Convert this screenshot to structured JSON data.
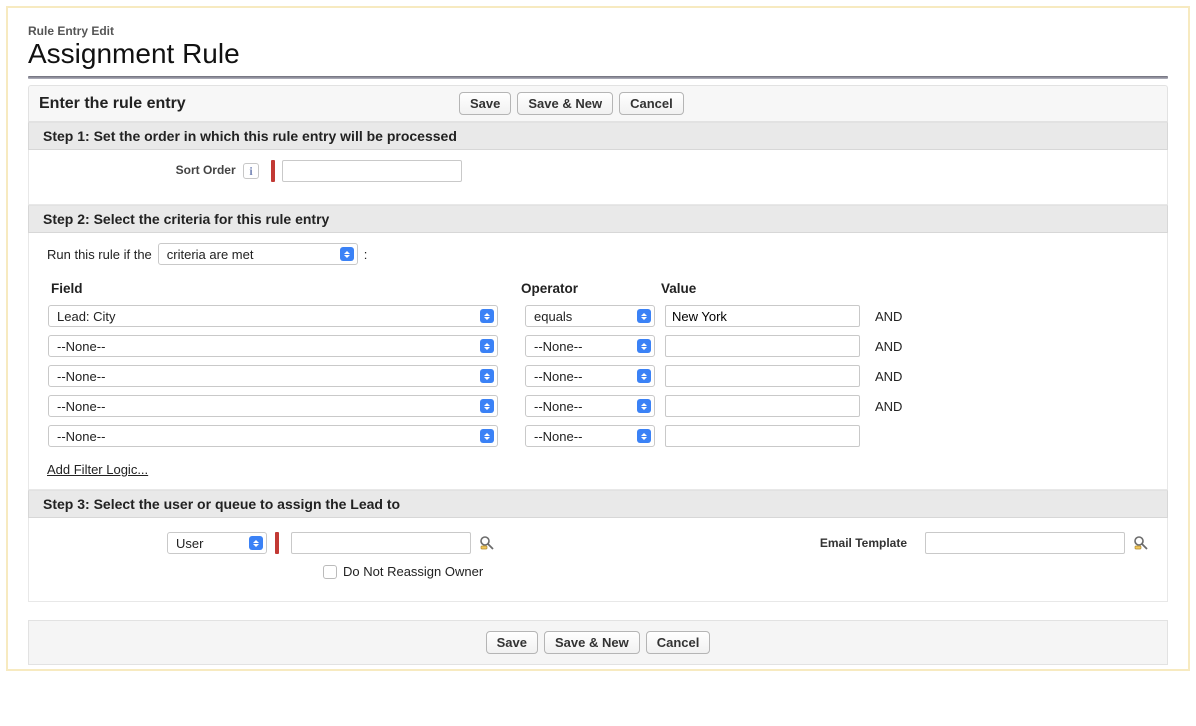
{
  "header": {
    "subtitle": "Rule Entry Edit",
    "title": "Assignment Rule"
  },
  "topbar": {
    "heading": "Enter the rule entry"
  },
  "buttons": {
    "save": "Save",
    "save_new": "Save & New",
    "cancel": "Cancel"
  },
  "step1": {
    "title": "Step 1: Set the order in which this rule entry will be processed",
    "sort_order_label": "Sort Order",
    "sort_order_value": ""
  },
  "step2": {
    "title": "Step 2: Select the criteria for this rule entry",
    "run_prefix": "Run this rule if the",
    "run_select": "criteria are met",
    "colon": ":",
    "cols": {
      "field": "Field",
      "operator": "Operator",
      "value": "Value"
    },
    "and_label": "AND",
    "rows": [
      {
        "field": "Lead: City",
        "operator": "equals",
        "value": "New York",
        "show_and": true
      },
      {
        "field": "--None--",
        "operator": "--None--",
        "value": "",
        "show_and": true
      },
      {
        "field": "--None--",
        "operator": "--None--",
        "value": "",
        "show_and": true
      },
      {
        "field": "--None--",
        "operator": "--None--",
        "value": "",
        "show_and": true
      },
      {
        "field": "--None--",
        "operator": "--None--",
        "value": "",
        "show_and": false
      }
    ],
    "add_filter_logic": "Add Filter Logic..."
  },
  "step3": {
    "title": "Step 3: Select the user or queue to assign the Lead to",
    "assign_type": "User",
    "assign_value": "",
    "email_template_label": "Email Template",
    "email_template_value": "",
    "do_not_reassign_label": "Do Not Reassign Owner",
    "do_not_reassign_checked": false
  }
}
